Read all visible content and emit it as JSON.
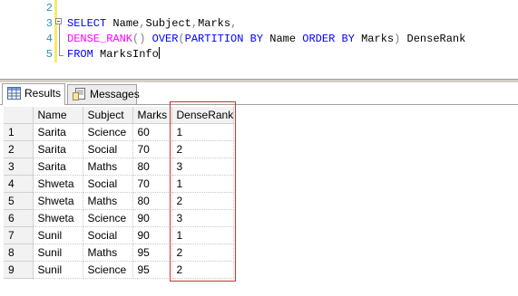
{
  "editor": {
    "line_numbers": [
      "2",
      "3",
      "4",
      "5"
    ],
    "lines": [
      {
        "parts": []
      },
      {
        "parts": [
          {
            "cls": "kw",
            "text": "SELECT"
          },
          {
            "cls": "tx",
            "text": " Name"
          },
          {
            "cls": "gr",
            "text": ","
          },
          {
            "cls": "tx",
            "text": "Subject"
          },
          {
            "cls": "gr",
            "text": ","
          },
          {
            "cls": "tx",
            "text": "Marks"
          },
          {
            "cls": "gr",
            "text": ","
          }
        ]
      },
      {
        "parts": [
          {
            "cls": "fn",
            "text": "DENSE_RANK"
          },
          {
            "cls": "gr",
            "text": "()"
          },
          {
            "cls": "tx",
            "text": " "
          },
          {
            "cls": "kw",
            "text": "OVER"
          },
          {
            "cls": "gr",
            "text": "("
          },
          {
            "cls": "kw",
            "text": "PARTITION BY"
          },
          {
            "cls": "tx",
            "text": " Name "
          },
          {
            "cls": "kw",
            "text": "ORDER BY"
          },
          {
            "cls": "tx",
            "text": " Marks"
          },
          {
            "cls": "gr",
            "text": ")"
          },
          {
            "cls": "tx",
            "text": " DenseRank"
          }
        ]
      },
      {
        "parts": [
          {
            "cls": "kw",
            "text": "FROM"
          },
          {
            "cls": "tx",
            "text": " MarksInfo"
          }
        ]
      }
    ]
  },
  "tabs": {
    "results_label": "Results",
    "messages_label": "Messages"
  },
  "grid": {
    "columns": [
      "Name",
      "Subject",
      "Marks",
      "DenseRank"
    ],
    "rows": [
      [
        "1",
        "Sarita",
        "Science",
        "60",
        "1"
      ],
      [
        "2",
        "Sarita",
        "Social",
        "70",
        "2"
      ],
      [
        "3",
        "Sarita",
        "Maths",
        "80",
        "3"
      ],
      [
        "4",
        "Shweta",
        "Social",
        "70",
        "1"
      ],
      [
        "5",
        "Shweta",
        "Maths",
        "80",
        "2"
      ],
      [
        "6",
        "Shweta",
        "Science",
        "90",
        "3"
      ],
      [
        "7",
        "Sunil",
        "Social",
        "90",
        "1"
      ],
      [
        "8",
        "Sunil",
        "Maths",
        "95",
        "2"
      ],
      [
        "9",
        "Sunil",
        "Science",
        "95",
        "2"
      ]
    ]
  },
  "colors": {
    "keyword": "#0000ff",
    "function": "#ff00ff",
    "operator": "#808080",
    "line_number": "#2b91af",
    "highlight_box": "#cc3333"
  },
  "icons": {
    "results_tab": "grid-icon",
    "messages_tab": "messages-icon"
  }
}
